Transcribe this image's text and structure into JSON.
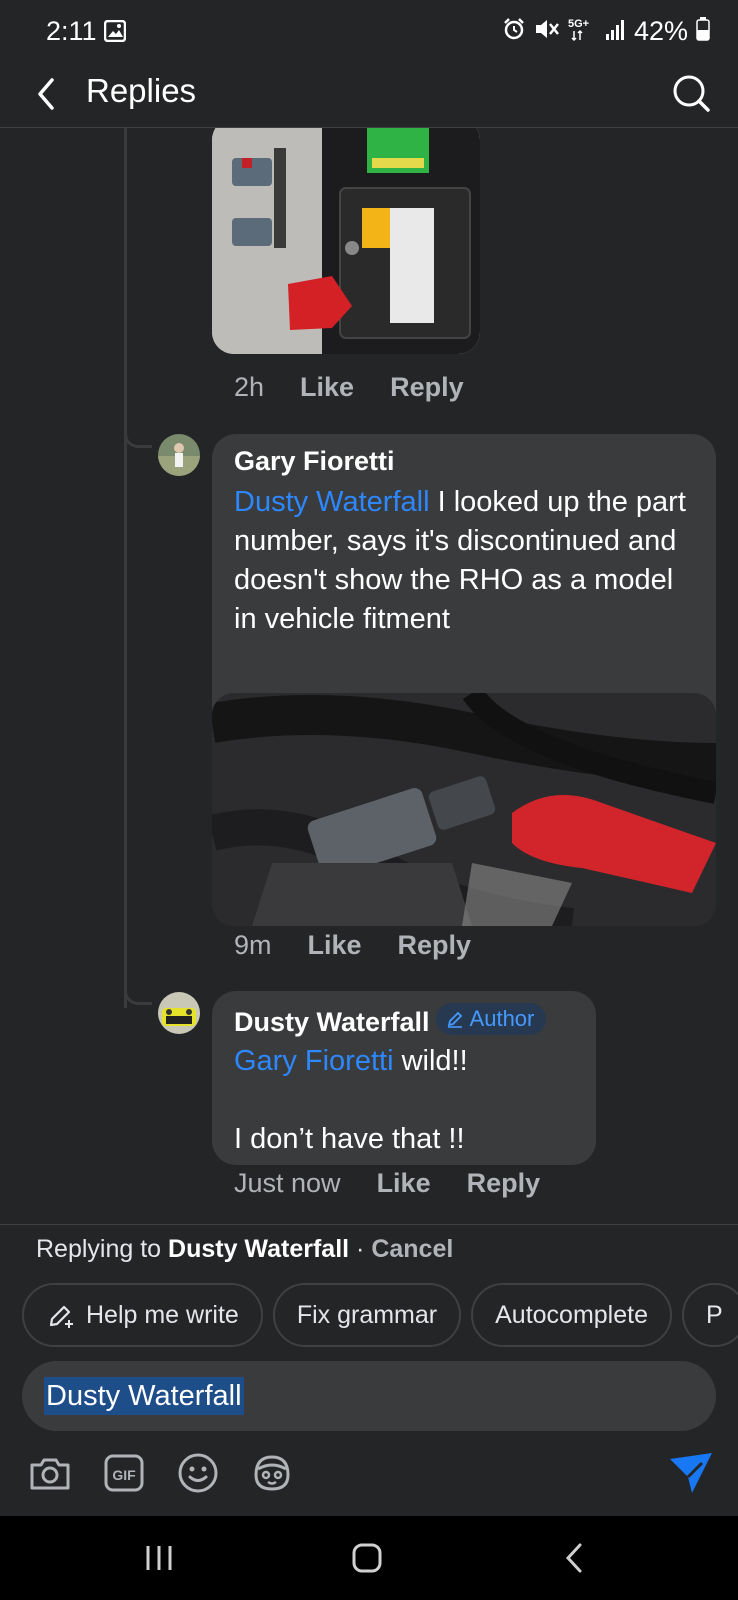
{
  "status": {
    "time": "2:11",
    "battery": "42%",
    "network": "5G"
  },
  "header": {
    "title": "Replies"
  },
  "thread": {
    "first_meta": {
      "time": "2h",
      "like": "Like",
      "reply": "Reply"
    },
    "comments": [
      {
        "author": "Gary Fioretti",
        "mention": "Dusty Waterfall",
        "text": " I looked up the part number, says it's discontinued and doesn't show the RHO as a model in vehicle fitment",
        "time": "9m",
        "like": "Like",
        "reply": "Reply"
      },
      {
        "author": "Dusty Waterfall",
        "badge": "Author",
        "mention": "Gary Fioretti",
        "text_line1": " wild!!",
        "text_line2": "I don’t have that !!",
        "time": "Just now",
        "like": "Like",
        "reply": "Reply"
      }
    ]
  },
  "composer": {
    "replying_prefix": "Replying to ",
    "replying_name": "Dusty Waterfall",
    "separator": " · ",
    "cancel": "Cancel",
    "chips": [
      "Help me write",
      "Fix grammar",
      "Autocomplete",
      "P"
    ],
    "input_value": "Dusty Waterfall"
  },
  "colors": {
    "background": "#242526",
    "bubble": "#3a3b3c",
    "mention": "#2d88ff",
    "send": "#1877f2"
  }
}
